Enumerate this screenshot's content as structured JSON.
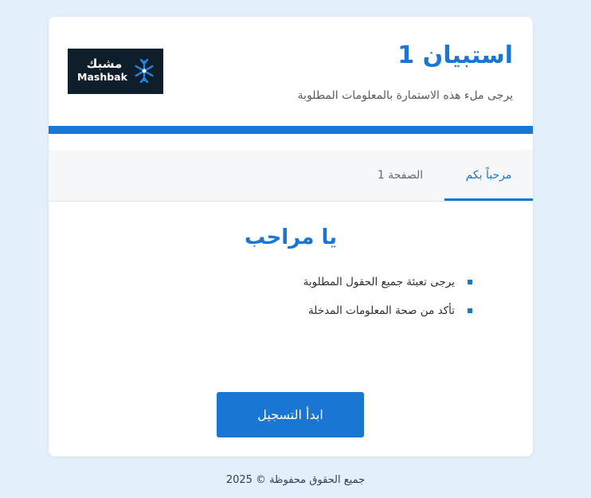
{
  "form": {
    "title": "استبيان 1",
    "subtitle": "يرجى ملء هذه الاستمارة بالمعلومات المطلوبة"
  },
  "logo": {
    "text": "Mashbak",
    "text_ar": "مشبك",
    "icon": "snowflake-logo-icon",
    "accent_color": "#1e88e5"
  },
  "tabs": [
    {
      "label": "مرحباً بكم",
      "active": true
    },
    {
      "label": "الصفحة 1",
      "active": false
    }
  ],
  "welcome": {
    "heading": "يا مراحب",
    "instructions": [
      "يرجى تعبئة جميع الحقول المطلوبة",
      "تأكد من صحة المعلومات المدخلة"
    ],
    "start_label": "ابدأ التسجيل"
  },
  "footer": {
    "text": "جميع الحقوق محفوظة © 2025"
  },
  "colors": {
    "accent": "#1976d2",
    "page_background": "#e3f0fb",
    "card_background": "#ffffff"
  }
}
